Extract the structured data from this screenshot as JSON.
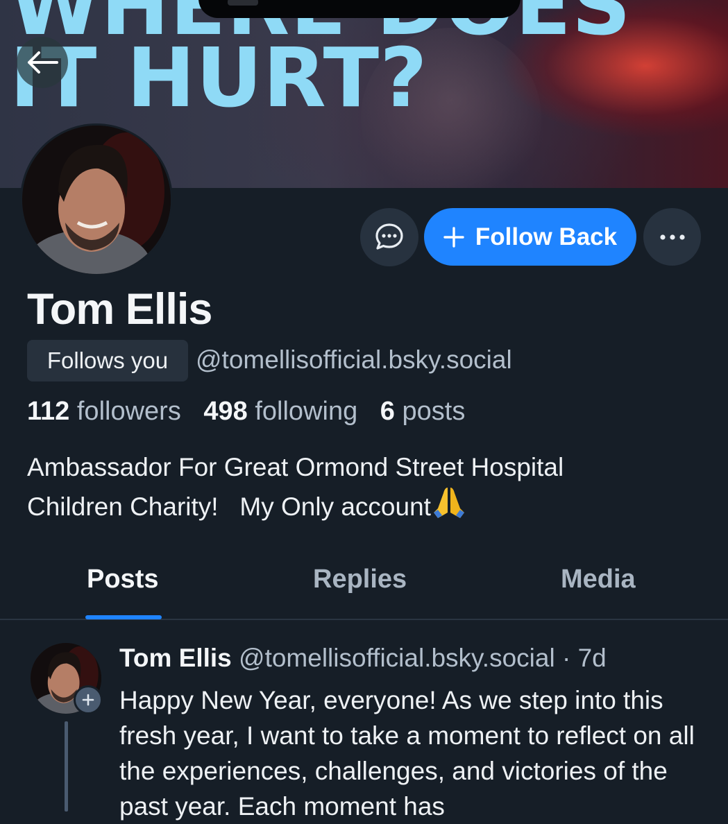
{
  "banner": {
    "headline": "WHERE DOES\nIT HURT?"
  },
  "header": {
    "back_icon": "arrow-left-icon"
  },
  "actions": {
    "message_icon": "chat-bubble-icon",
    "follow_label": "Follow Back",
    "follow_icon": "plus-icon",
    "more_icon": "ellipsis-icon"
  },
  "profile": {
    "name": "Tom Ellis",
    "follows_you": "Follows you",
    "handle": "@tomellisofficial.bsky.social",
    "stats": {
      "followers_count": "112",
      "followers_label": "followers",
      "following_count": "498",
      "following_label": "following",
      "posts_count": "6",
      "posts_label": "posts"
    },
    "bio": "Ambassador For Great Ormond Street Hospital\nChildren Charity!   My Only account"
  },
  "tabs": [
    {
      "label": "Posts",
      "active": true
    },
    {
      "label": "Replies",
      "active": false
    },
    {
      "label": "Media",
      "active": false
    }
  ],
  "post": {
    "author": "Tom Ellis",
    "meta": "@tomellisofficial.bsky.social · 7d",
    "text": "Happy New Year, everyone! As we step into this fresh year, I want to take a moment to reflect on all the experiences, challenges, and victories of the past year. Each moment has"
  },
  "colors": {
    "background": "#161e27",
    "accent": "#1f84ff",
    "banner_text": "#8fdaf6"
  }
}
